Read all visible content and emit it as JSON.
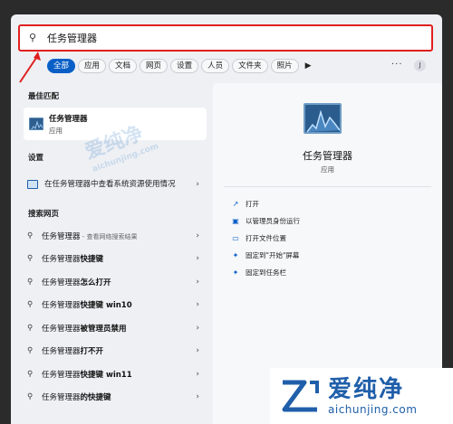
{
  "search": {
    "value": "任务管理器"
  },
  "filters": [
    "全部",
    "应用",
    "文档",
    "网页",
    "设置",
    "人员",
    "文件夹",
    "照片"
  ],
  "filters_more": "▶",
  "more_dots": "···",
  "avatar_initial": "J",
  "best_match": {
    "section": "最佳匹配",
    "name": "任务管理器",
    "type": "应用"
  },
  "settings": {
    "section": "设置",
    "item": "在任务管理器中查看系统资源使用情况"
  },
  "web": {
    "section": "搜索网页",
    "items": [
      {
        "prefix": "任务管理器",
        "bold": "",
        "hint": " - 查看网络搜索结果"
      },
      {
        "prefix": "任务管理器",
        "bold": "快捷键",
        "hint": ""
      },
      {
        "prefix": "任务管理器",
        "bold": "怎么打开",
        "hint": ""
      },
      {
        "prefix": "任务管理器",
        "bold": "快捷键 win10",
        "hint": ""
      },
      {
        "prefix": "任务管理器",
        "bold": "被管理员禁用",
        "hint": ""
      },
      {
        "prefix": "任务管理器",
        "bold": "打不开",
        "hint": ""
      },
      {
        "prefix": "任务管理器",
        "bold": "快捷键 win11",
        "hint": ""
      },
      {
        "prefix": "任务管理器",
        "bold": "的快捷键",
        "hint": ""
      }
    ]
  },
  "preview": {
    "name": "任务管理器",
    "type": "应用",
    "actions": [
      {
        "icon": "open-icon",
        "label": "打开"
      },
      {
        "icon": "shield-icon",
        "label": "以管理员身份运行"
      },
      {
        "icon": "folder-icon",
        "label": "打开文件位置"
      },
      {
        "icon": "pin-icon",
        "label": "固定到\"开始\"屏幕"
      },
      {
        "icon": "pin-icon",
        "label": "固定到任务栏"
      }
    ]
  },
  "watermark": {
    "cn": "爱纯净",
    "en": "aichunjing.com"
  },
  "colors": {
    "accent": "#0a5fc7",
    "highlight": "#e02020"
  }
}
